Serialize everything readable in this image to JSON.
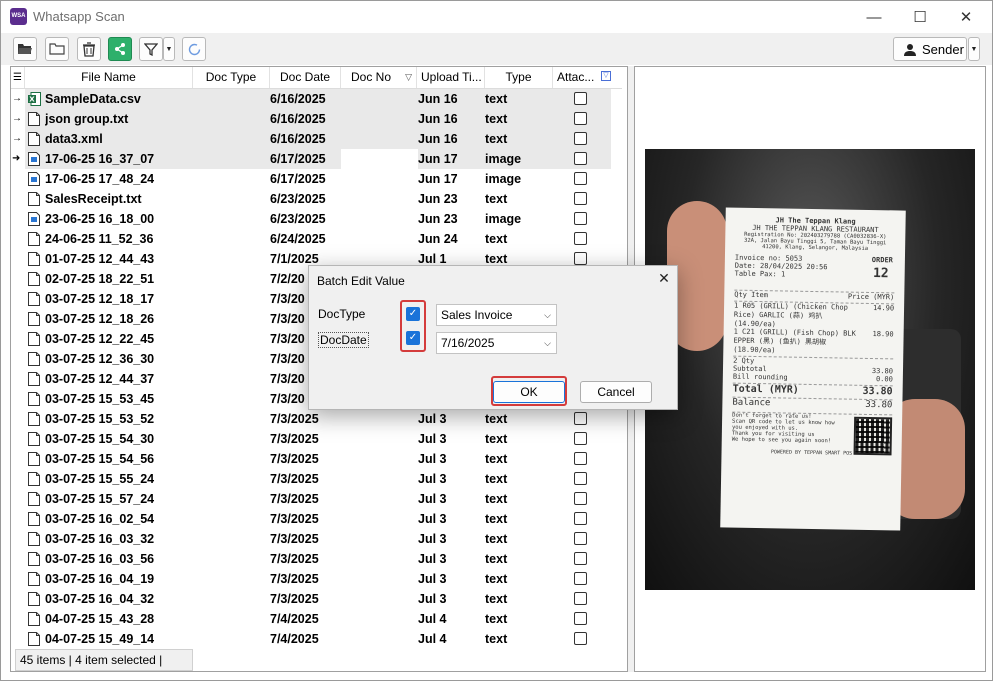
{
  "app": {
    "title": "Whatsapp Scan",
    "icon_text": "WSA"
  },
  "window_controls": {
    "minimize": "—",
    "maximize": "☐",
    "close": "✕"
  },
  "toolbar": {
    "sender_label": "Sender"
  },
  "table": {
    "columns": [
      "File Name",
      "Doc Type",
      "Doc Date",
      "Doc No",
      "Upload Ti...",
      "Type",
      "Attac..."
    ],
    "rows": [
      {
        "arrow": "→",
        "icon": "csv",
        "name": "SampleData.csv",
        "doc_date": "6/16/2025",
        "upload": "Jun 16",
        "type": "text",
        "selected": true
      },
      {
        "arrow": "→",
        "icon": "doc",
        "name": "json group.txt",
        "doc_date": "6/16/2025",
        "upload": "Jun 16",
        "type": "text",
        "selected": true
      },
      {
        "arrow": "→",
        "icon": "doc",
        "name": "data3.xml",
        "doc_date": "6/16/2025",
        "upload": "Jun 16",
        "type": "text",
        "selected": true
      },
      {
        "arrow": "➜",
        "icon": "img",
        "name": "17-06-25 16_37_07",
        "doc_date": "6/17/2025",
        "upload": "Jun 17",
        "type": "image",
        "selected": true
      },
      {
        "arrow": "",
        "icon": "img",
        "name": "17-06-25 17_48_24",
        "doc_date": "6/17/2025",
        "upload": "Jun 17",
        "type": "image",
        "selected": false
      },
      {
        "arrow": "",
        "icon": "doc",
        "name": "SalesReceipt.txt",
        "doc_date": "6/23/2025",
        "upload": "Jun 23",
        "type": "text",
        "selected": false
      },
      {
        "arrow": "",
        "icon": "img",
        "name": "23-06-25 16_18_00",
        "doc_date": "6/23/2025",
        "upload": "Jun 23",
        "type": "image",
        "selected": false
      },
      {
        "arrow": "",
        "icon": "doc",
        "name": "24-06-25 11_52_36",
        "doc_date": "6/24/2025",
        "upload": "Jun 24",
        "type": "text",
        "selected": false
      },
      {
        "arrow": "",
        "icon": "doc",
        "name": "01-07-25 12_44_43",
        "doc_date": "7/1/2025",
        "upload": "Jul 1",
        "type": "text",
        "selected": false
      },
      {
        "arrow": "",
        "icon": "doc",
        "name": "02-07-25 18_22_51",
        "doc_date": "7/2/20",
        "upload": "",
        "type": "",
        "selected": false
      },
      {
        "arrow": "",
        "icon": "doc",
        "name": "03-07-25 12_18_17",
        "doc_date": "7/3/20",
        "upload": "",
        "type": "",
        "selected": false
      },
      {
        "arrow": "",
        "icon": "doc",
        "name": "03-07-25 12_18_26",
        "doc_date": "7/3/20",
        "upload": "",
        "type": "",
        "selected": false
      },
      {
        "arrow": "",
        "icon": "doc",
        "name": "03-07-25 12_22_45",
        "doc_date": "7/3/20",
        "upload": "",
        "type": "",
        "selected": false
      },
      {
        "arrow": "",
        "icon": "doc",
        "name": "03-07-25 12_36_30",
        "doc_date": "7/3/20",
        "upload": "",
        "type": "",
        "selected": false
      },
      {
        "arrow": "",
        "icon": "doc",
        "name": "03-07-25 12_44_37",
        "doc_date": "7/3/20",
        "upload": "",
        "type": "",
        "selected": false
      },
      {
        "arrow": "",
        "icon": "doc",
        "name": "03-07-25 15_53_45",
        "doc_date": "7/3/20",
        "upload": "",
        "type": "",
        "selected": false
      },
      {
        "arrow": "",
        "icon": "doc",
        "name": "03-07-25 15_53_52",
        "doc_date": "7/3/2025",
        "upload": "Jul 3",
        "type": "text",
        "selected": false
      },
      {
        "arrow": "",
        "icon": "doc",
        "name": "03-07-25 15_54_30",
        "doc_date": "7/3/2025",
        "upload": "Jul 3",
        "type": "text",
        "selected": false
      },
      {
        "arrow": "",
        "icon": "doc",
        "name": "03-07-25 15_54_56",
        "doc_date": "7/3/2025",
        "upload": "Jul 3",
        "type": "text",
        "selected": false
      },
      {
        "arrow": "",
        "icon": "doc",
        "name": "03-07-25 15_55_24",
        "doc_date": "7/3/2025",
        "upload": "Jul 3",
        "type": "text",
        "selected": false
      },
      {
        "arrow": "",
        "icon": "doc",
        "name": "03-07-25 15_57_24",
        "doc_date": "7/3/2025",
        "upload": "Jul 3",
        "type": "text",
        "selected": false
      },
      {
        "arrow": "",
        "icon": "doc",
        "name": "03-07-25 16_02_54",
        "doc_date": "7/3/2025",
        "upload": "Jul 3",
        "type": "text",
        "selected": false
      },
      {
        "arrow": "",
        "icon": "doc",
        "name": "03-07-25 16_03_32",
        "doc_date": "7/3/2025",
        "upload": "Jul 3",
        "type": "text",
        "selected": false
      },
      {
        "arrow": "",
        "icon": "doc",
        "name": "03-07-25 16_03_56",
        "doc_date": "7/3/2025",
        "upload": "Jul 3",
        "type": "text",
        "selected": false
      },
      {
        "arrow": "",
        "icon": "doc",
        "name": "03-07-25 16_04_19",
        "doc_date": "7/3/2025",
        "upload": "Jul 3",
        "type": "text",
        "selected": false
      },
      {
        "arrow": "",
        "icon": "doc",
        "name": "03-07-25 16_04_32",
        "doc_date": "7/3/2025",
        "upload": "Jul 3",
        "type": "text",
        "selected": false
      },
      {
        "arrow": "",
        "icon": "doc",
        "name": "04-07-25 15_43_28",
        "doc_date": "7/4/2025",
        "upload": "Jul 4",
        "type": "text",
        "selected": false
      },
      {
        "arrow": "",
        "icon": "doc",
        "name": "04-07-25 15_49_14",
        "doc_date": "7/4/2025",
        "upload": "Jul 4",
        "type": "text",
        "selected": false
      }
    ]
  },
  "status_bar": {
    "text": "45 items |  4 item selected |"
  },
  "dialog": {
    "title": "Batch Edit Value",
    "close": "✕",
    "doctype_label": "DocType",
    "docdate_label": "DocDate",
    "doctype_value": "Sales Invoice",
    "docdate_value": "7/16/2025",
    "ok_label": "OK",
    "cancel_label": "Cancel",
    "check_mark": "✓"
  },
  "receipt": {
    "lines": [
      "JH The Teppan Klang",
      "JH THE TEPPAN KLANG RESTAURANT",
      "Registration No: 202403279788 (CA0032836-X)",
      "32A, Jalan Bayu Tinggi 5, Taman Bayu Tinggi",
      "41200, Klang, Selangor, Malaysia"
    ],
    "invoice_no": "Invoice no: 5053",
    "date": "Date: 28/04/2025 20:56",
    "table_pax": "Table Pax: 1",
    "order_label": "ORDER",
    "order_no": "12",
    "col_qty_item": "Qty Item",
    "col_price": "Price (MYR)",
    "item1": "1   R05 (GRILL) (Chicken Chop",
    "item1b": "    Rice) GARLIC (蒜) 鸡扒",
    "item1c": "    (14.90/ea)",
    "item1_price": "14.90",
    "item2": "1   C21 (GRILL) (Fish Chop) BLK",
    "item2b": "    EPPER (黑) (鱼扒) 黑胡椒",
    "item2c": "    (18.90/ea)",
    "item2_price": "18.90",
    "qty": "2   Qty",
    "subtotal_label": "Subtotal",
    "subtotal": "33.80",
    "rounding_label": "Bill rounding",
    "rounding": "0.00",
    "total_label": "Total (MYR)",
    "total": "33.80",
    "balance_label": "Balance",
    "balance": "33.80",
    "footer1": "Don't forget to rate us!",
    "footer2": "Scan QR code to let us know how",
    "footer3": "you enjoyed with us.",
    "footer4": "Thank you for visiting us",
    "footer5": "We hope to see you again soon!",
    "footer6": "POWERED BY TEPPAN SMART POS"
  },
  "colors": {
    "accent": "#1a73d9",
    "highlight": "#d43c3c",
    "selected_row": "#e9e9e9",
    "app_icon": "#5b2d8e"
  }
}
